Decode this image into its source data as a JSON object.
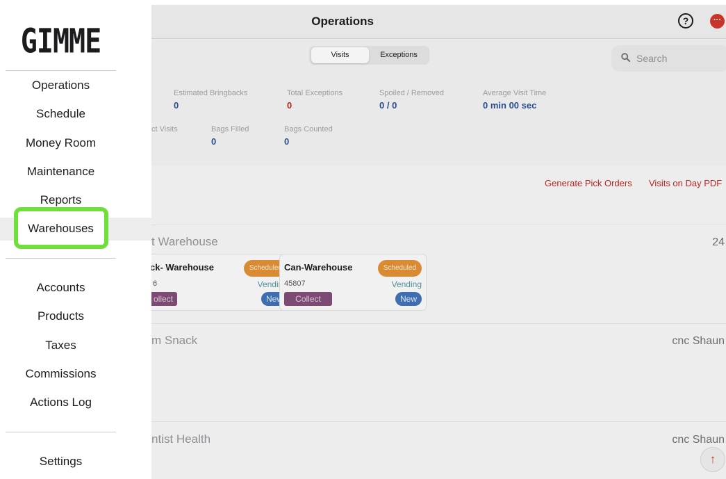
{
  "header": {
    "title": "Operations",
    "help_icon": "?",
    "more_icon": "···",
    "accent_color": "#c9342a"
  },
  "tabs": [
    {
      "label": "Visits",
      "active": true
    },
    {
      "label": "Exceptions",
      "active": false
    }
  ],
  "search": {
    "placeholder": "Search"
  },
  "stats": {
    "row1": [
      {
        "label": "Estimated Bringbacks",
        "value": "0",
        "color": "#2b4e8a"
      },
      {
        "label": "Total Exceptions",
        "value": "0",
        "color": "#b3261e"
      },
      {
        "label": "Spoiled / Removed",
        "value": "0 / 0",
        "color": "#2b4e8a"
      },
      {
        "label": "Average Visit Time",
        "value": "0 min 00 sec",
        "color": "#2b4e8a"
      }
    ],
    "row2": [
      {
        "label": "ct Visits",
        "value": ""
      },
      {
        "label": "Bags Filled",
        "value": "0"
      },
      {
        "label": "Bags Counted",
        "value": "0"
      }
    ]
  },
  "actions": {
    "generate_pick_orders": "Generate Pick Orders",
    "visits_on_day_pdf": "Visits on Day PDF"
  },
  "groups": [
    {
      "name": "t Warehouse",
      "right": "24",
      "cards": [
        {
          "name": "ck- Warehouse",
          "status": "Scheduled",
          "number": "6",
          "type": "Vending",
          "collect": "ollect",
          "badge": "New"
        },
        {
          "name": "Can-Warehouse",
          "status": "Scheduled",
          "number": "45807",
          "type": "Vending",
          "collect": "Collect",
          "badge": "New"
        }
      ]
    },
    {
      "name": "m Snack",
      "right": "cnc Shaun",
      "cards": []
    },
    {
      "name": "ntist Health",
      "right": "cnc Shaun",
      "cards": []
    }
  ],
  "scroll_top": "↑",
  "sidebar": {
    "logo": "GIMME",
    "items_top": [
      "Operations",
      "Schedule",
      "Money Room",
      "Maintenance",
      "Reports",
      "Warehouses"
    ],
    "selected": "Warehouses",
    "items_mid": [
      "Accounts",
      "Products",
      "Taxes",
      "Commissions",
      "Actions Log"
    ],
    "items_bottom": [
      "Settings"
    ],
    "highlight_color": "#6fe03a"
  }
}
